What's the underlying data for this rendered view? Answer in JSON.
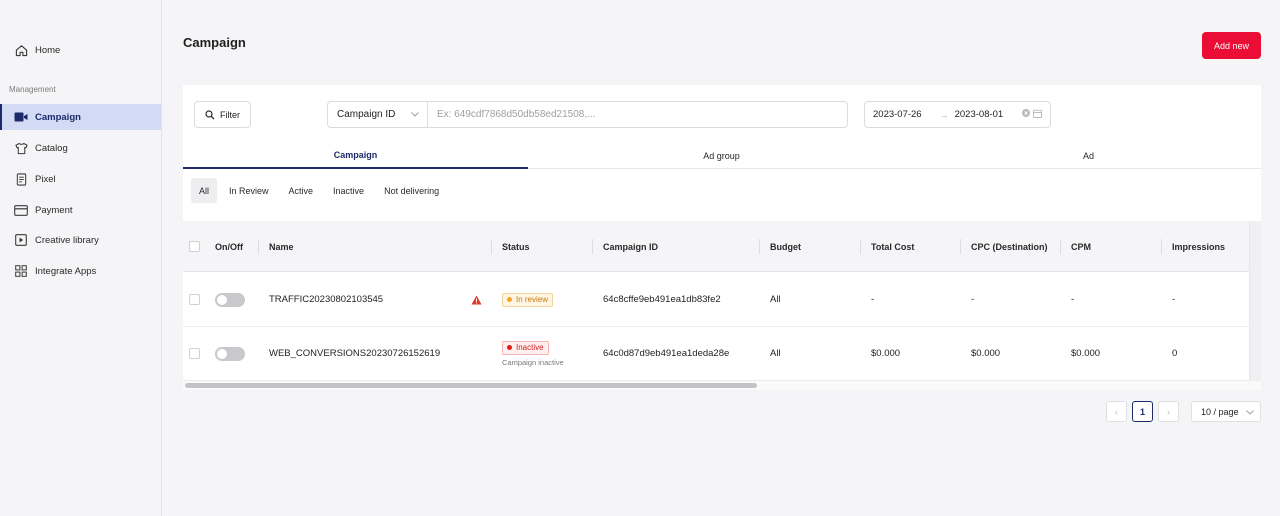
{
  "sidebar": {
    "items": [
      {
        "label": "Home",
        "icon": "home-icon"
      },
      {
        "label": "Campaign",
        "icon": "video-icon"
      },
      {
        "label": "Catalog",
        "icon": "shirt-icon"
      },
      {
        "label": "Pixel",
        "icon": "document-icon"
      },
      {
        "label": "Payment",
        "icon": "card-icon"
      },
      {
        "label": "Creative library",
        "icon": "play-icon"
      },
      {
        "label": "Integrate Apps",
        "icon": "grid-icon"
      }
    ],
    "section_label": "Management",
    "active": "Campaign"
  },
  "header": {
    "title": "Campaign",
    "add_button": "Add new"
  },
  "toolbar": {
    "filter_label": "Filter",
    "search_field": "Campaign ID",
    "search_placeholder": "Ex: 649cdf7868d50db58ed21508,...",
    "date_start": "2023-07-26",
    "date_arrow": "→",
    "date_end": "2023-08-01"
  },
  "tabs": [
    "Campaign",
    "Ad group",
    "Ad"
  ],
  "active_tab": "Campaign",
  "subtabs": [
    "All",
    "In Review",
    "Active",
    "Inactive",
    "Not delivering"
  ],
  "active_subtab": "All",
  "table": {
    "columns": [
      "On/Off",
      "Name",
      "Status",
      "Campaign ID",
      "Budget",
      "Total Cost",
      "CPC (Destination)",
      "CPM",
      "Impressions"
    ],
    "rows": [
      {
        "name": "TRAFFIC20230802103545",
        "warning": true,
        "status": "In review",
        "status_note": "",
        "campaign_id": "64c8cffe9eb491ea1db83fe2",
        "budget": "All",
        "total_cost": "-",
        "cpc": "-",
        "cpm": "-",
        "impressions": "-"
      },
      {
        "name": "WEB_CONVERSIONS20230726152619",
        "warning": false,
        "status": "Inactive",
        "status_note": "Campaign inactive",
        "campaign_id": "64c0d87d9eb491ea1deda28e",
        "budget": "All",
        "total_cost": "$0.000",
        "cpc": "$0.000",
        "cpm": "$0.000",
        "impressions": "0"
      }
    ]
  },
  "pagination": {
    "prev": "‹",
    "current_page": "1",
    "next": "›",
    "page_size": "10 / page"
  },
  "colors": {
    "accent": "#1c2a6b",
    "primary_button": "#ea0d35",
    "active_nav_bg": "#d2dbf3"
  }
}
